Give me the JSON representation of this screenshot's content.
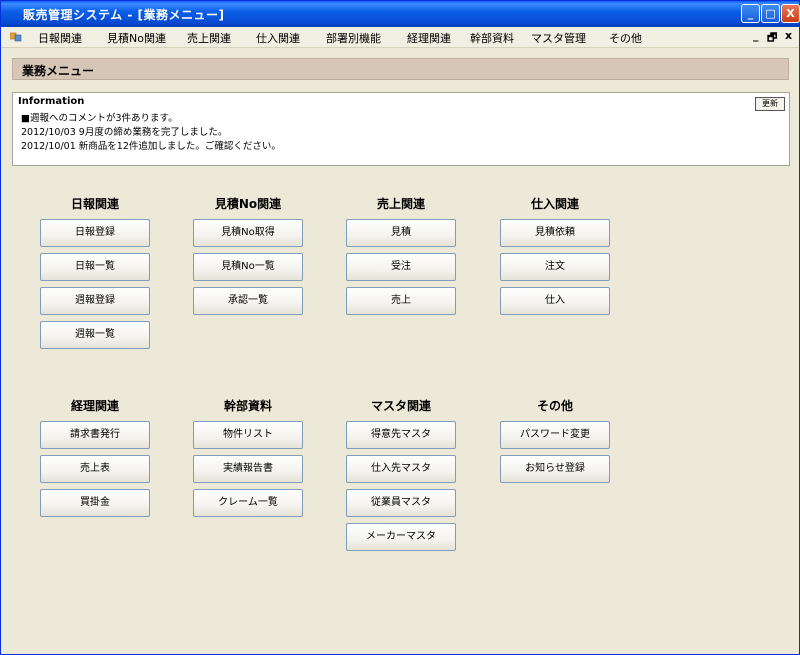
{
  "window": {
    "title": "販売管理システム - [業務メニュー]",
    "controls": {
      "minimize": "_",
      "maximize": "□",
      "close": "X"
    }
  },
  "menubar": {
    "items": [
      "日報関連",
      "見積No関連",
      "売上関連",
      "仕入関連",
      "部署別機能",
      "経理関連",
      "幹部資料",
      "マスタ管理",
      "その他"
    ],
    "mdi_controls": {
      "minimize": "_",
      "restore": "🗗",
      "close": "x"
    }
  },
  "header": {
    "title": "業務メニュー"
  },
  "info": {
    "title": "Information",
    "refresh_label": "更新",
    "lines": [
      "■週報へのコメントが3件あります。",
      "2012/10/03  9月度の締め業務を完了しました。",
      "2012/10/01  新商品を12件追加しました。ご確認ください。"
    ]
  },
  "sections": [
    {
      "title": "日報関連",
      "buttons": [
        "日報登録",
        "日報一覧",
        "週報登録",
        "週報一覧"
      ]
    },
    {
      "title": "見積No関連",
      "buttons": [
        "見積No取得",
        "見積No一覧",
        "承認一覧"
      ]
    },
    {
      "title": "売上関連",
      "buttons": [
        "見積",
        "受注",
        "売上"
      ]
    },
    {
      "title": "仕入関連",
      "buttons": [
        "見積依頼",
        "注文",
        "仕入"
      ]
    },
    {
      "title": "経理関連",
      "buttons": [
        "請求書発行",
        "売上表",
        "買掛金"
      ]
    },
    {
      "title": "幹部資料",
      "buttons": [
        "物件リスト",
        "実績報告書",
        "クレーム一覧"
      ]
    },
    {
      "title": "マスタ関連",
      "buttons": [
        "得意先マスタ",
        "仕入先マスタ",
        "従業員マスタ",
        "メーカーマスタ"
      ]
    },
    {
      "title": "その他",
      "buttons": [
        "パスワード変更",
        "お知らせ登録"
      ]
    }
  ]
}
